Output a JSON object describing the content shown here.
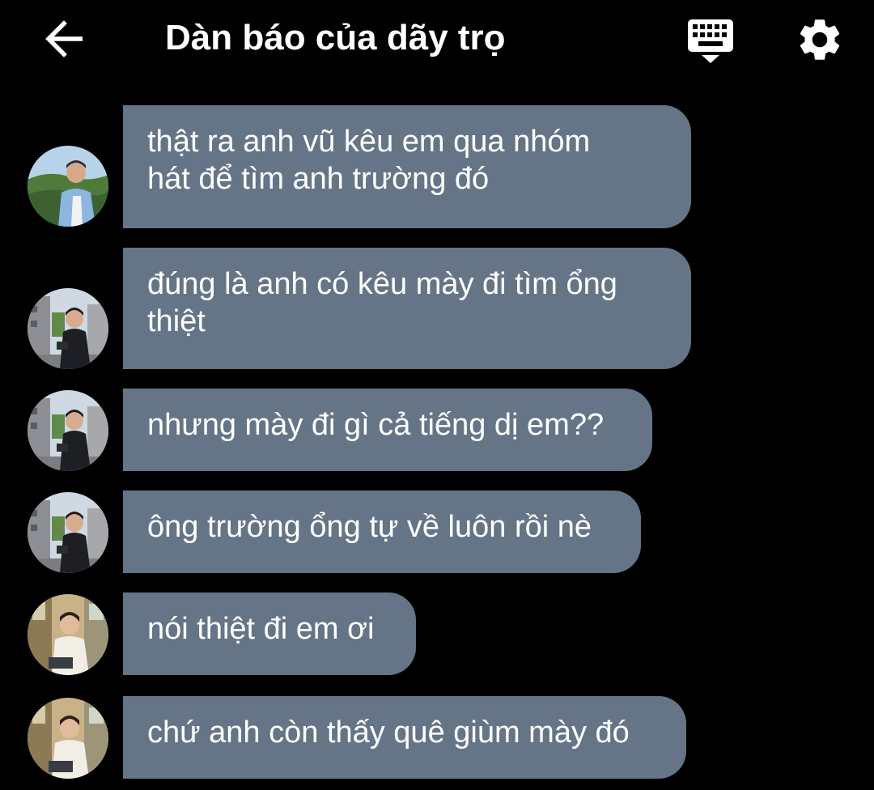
{
  "header": {
    "title": "Dàn báo của dãy trọ",
    "back_icon": "arrow-left-icon",
    "keyboard_icon": "keyboard-hide-icon",
    "settings_icon": "gear-icon"
  },
  "colors": {
    "background": "#000000",
    "bubble": "#657587",
    "text": "#ffffff"
  },
  "messages": [
    {
      "avatar": "avatar-outdoor-hills",
      "text": "thật ra anh vũ kêu em qua nhóm\nhát để tìm anh trường đó"
    },
    {
      "avatar": "avatar-street-camera",
      "text": "đúng là anh có kêu mày đi tìm ổng\nthiệt"
    },
    {
      "avatar": "avatar-street-camera",
      "text": "nhưng mày đi gì cả tiếng dị em??"
    },
    {
      "avatar": "avatar-street-camera",
      "text": "ông trường ổng tự về luôn rồi nè"
    },
    {
      "avatar": "avatar-cafe-sitting",
      "text": "nói thiệt đi em ơi"
    },
    {
      "avatar": "avatar-cafe-sitting",
      "text": "chứ anh còn thấy quê giùm mày đó"
    }
  ]
}
